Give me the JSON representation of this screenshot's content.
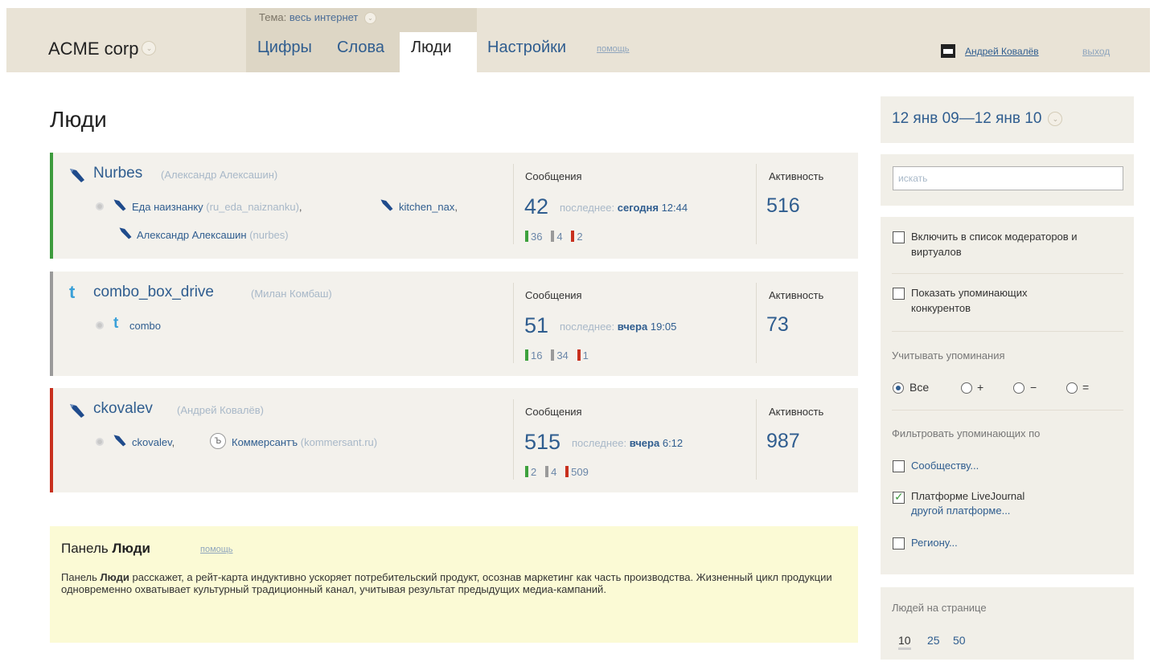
{
  "header": {
    "brand": "ACME corp",
    "topic_prefix": "Тема:",
    "topic_value": "весь интернет",
    "tabs": [
      "Цифры",
      "Слова",
      "Люди",
      "Настройки"
    ],
    "help": "помощь",
    "user": "Андрей Ковалёв",
    "logout": "выход"
  },
  "page": {
    "title": "Люди"
  },
  "people": [
    {
      "name": "Nurbes",
      "real_name": "(Александр Алексашин)",
      "icon": "livejournal-pen-icon",
      "accounts": [
        {
          "name": "Еда наизнанку",
          "id": "(ru_eda_naiznanku)",
          "sep": ","
        },
        {
          "name": "kitchen_nax",
          "id": "",
          "sep": ","
        },
        {
          "name": "Александр Алексашин",
          "id": "(nurbes)",
          "sep": ""
        }
      ],
      "messages_label": "Сообщения",
      "messages_count": "42",
      "last_label": "последнее:",
      "last_day": "сегодня",
      "last_time": "12:44",
      "pos": "36",
      "neu": "4",
      "neg": "2",
      "activity_label": "Активность",
      "activity": "516"
    },
    {
      "name": "combo_box_drive",
      "real_name": "(Милан Комбаш)",
      "icon": "twitter-icon",
      "accounts": [
        {
          "name": "combo",
          "id": "",
          "sep": ""
        }
      ],
      "messages_label": "Сообщения",
      "messages_count": "51",
      "last_label": "последнее:",
      "last_day": "вчера",
      "last_time": "19:05",
      "pos": "16",
      "neu": "34",
      "neg": "1",
      "activity_label": "Активность",
      "activity": "73"
    },
    {
      "name": "ckovalev",
      "real_name": "(Андрей Ковалёв)",
      "icon": "livejournal-pen-icon",
      "accounts": [
        {
          "name": "ckovalev",
          "id": "",
          "sep": ","
        },
        {
          "name": "Коммерсантъ",
          "id": "(kommersant.ru)",
          "sep": ""
        }
      ],
      "messages_label": "Сообщения",
      "messages_count": "515",
      "last_label": "последнее:",
      "last_day": "вчера",
      "last_time": "6:12",
      "pos": "2",
      "neu": "4",
      "neg": "509",
      "activity_label": "Активность",
      "activity": "987"
    }
  ],
  "help_panel": {
    "title_prefix": "Панель",
    "title_bold": "Люди",
    "link": "помощь",
    "text_prefix": "Панель",
    "text_bold": "Люди",
    "text_rest": "расскажет, а рейт-карта индуктивно ускоряет потребительский продукт, осознав маркетинг как часть производства. Жизненный цикл продукции одновременно охватывает культурный традиционный канал, учитывая результат предыдущих медиа-кампаний."
  },
  "sidebar": {
    "date_range": "12 янв 09—12 янв 10",
    "search_placeholder": "искать",
    "include_moderators": "Включить в список модераторов и виртуалов",
    "show_competitors": "Показать упоминающих конкурентов",
    "mentions_label": "Учитывать упоминания",
    "mention_options": [
      "Все",
      "+",
      "−",
      "="
    ],
    "filter_label": "Фильтровать упоминающих по",
    "filter_community": "Сообществу...",
    "filter_platform": "Платформе LiveJournal",
    "filter_other_platform": "другой платформе...",
    "filter_region": "Региону...",
    "per_page_label": "Людей на странице",
    "per_page_options": [
      "10",
      "25",
      "50"
    ]
  },
  "colors": {
    "accent": "#2f5d8f",
    "positive": "#3da13d",
    "neutral": "#9a9a9a",
    "negative": "#c8301e",
    "header_bg": "#e9e3d6",
    "help_bg": "#fbfad5"
  }
}
